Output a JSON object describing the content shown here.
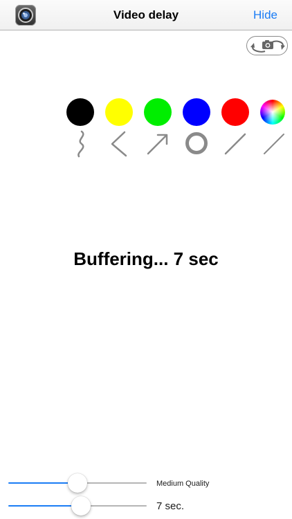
{
  "navbar": {
    "title": "Video delay",
    "hide_label": "Hide"
  },
  "palette": [
    {
      "name": "black",
      "color": "#000000"
    },
    {
      "name": "yellow",
      "color": "#ffff00"
    },
    {
      "name": "green",
      "color": "#00ee00"
    },
    {
      "name": "blue",
      "color": "#0000ff"
    },
    {
      "name": "red",
      "color": "#ff0000"
    },
    {
      "name": "color-wheel",
      "color": "rainbow"
    }
  ],
  "tools": [
    "freehand-icon",
    "angle-icon",
    "arrow-icon",
    "circle-icon",
    "line-icon",
    "line-icon"
  ],
  "colors": {
    "accent": "#1a7cf5",
    "track_inactive": "#b5b5b5",
    "tool_stroke": "#8a8a8a"
  },
  "status": {
    "text": "Buffering... 7 sec"
  },
  "sliders": {
    "quality": {
      "label": "Medium Quality",
      "value_fraction": 0.5
    },
    "delay": {
      "label": "7 sec.",
      "value_fraction": 0.53
    }
  }
}
